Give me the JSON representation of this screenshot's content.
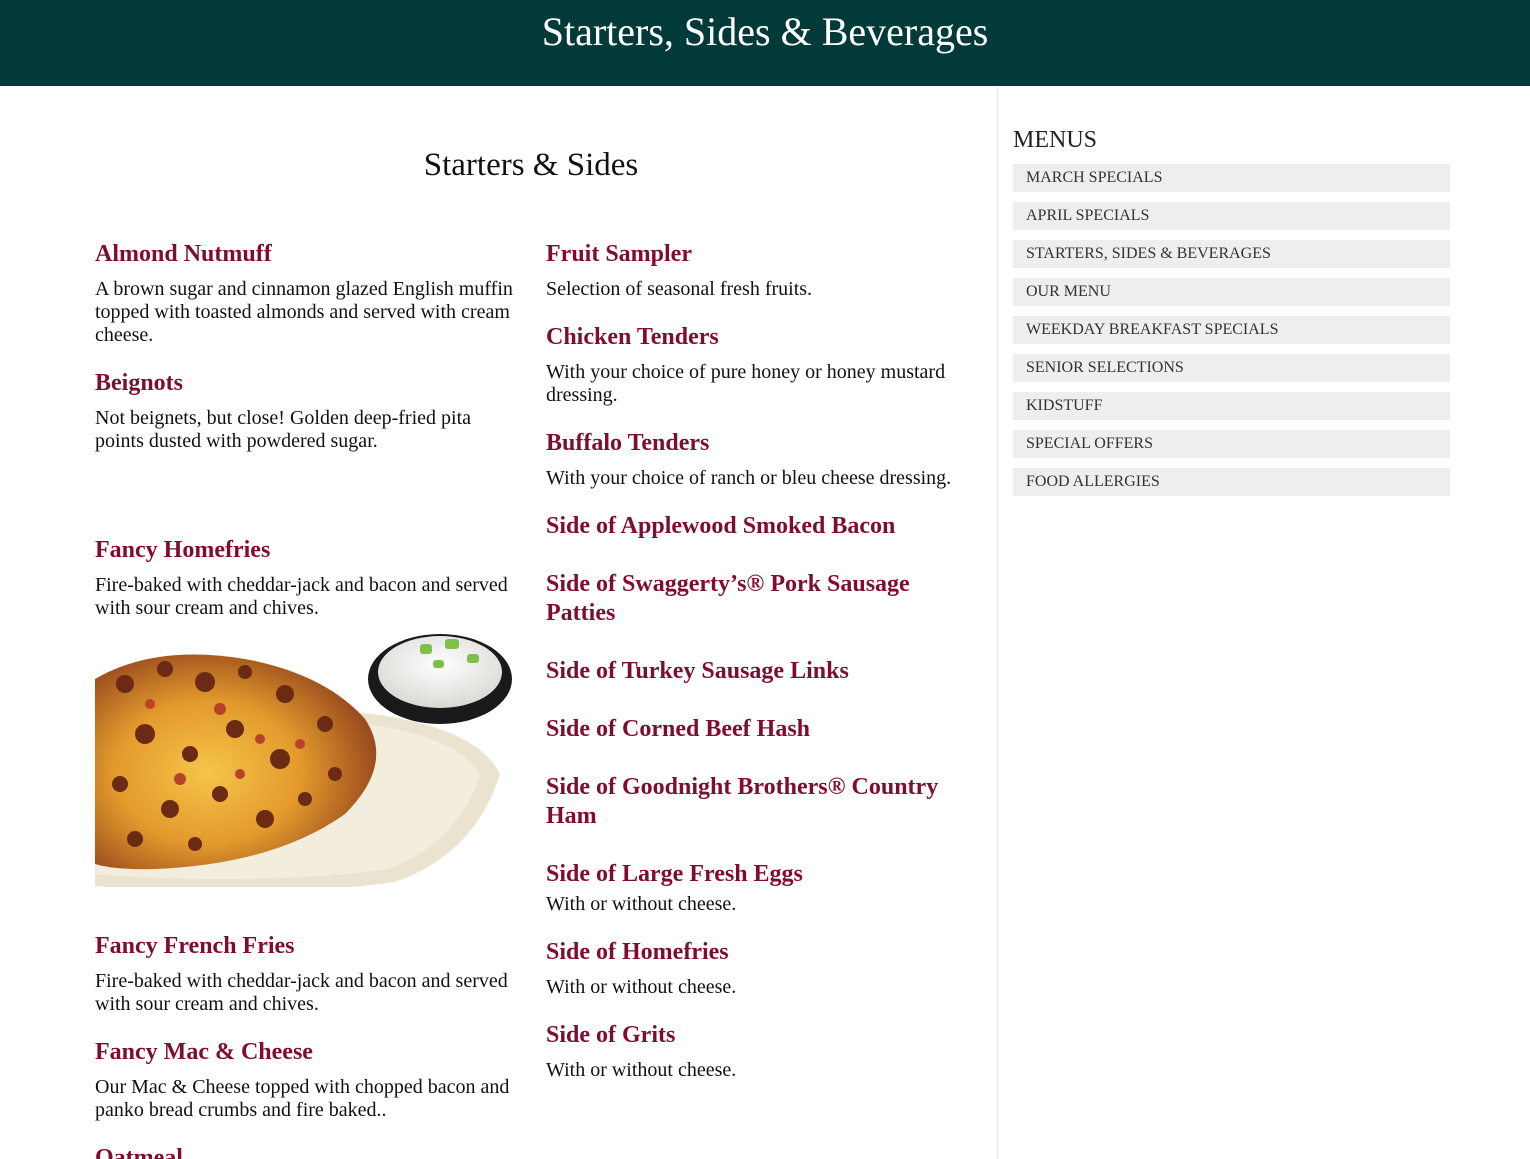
{
  "header": {
    "title": "Starters, Sides & Beverages"
  },
  "section": {
    "title": "Starters & Sides"
  },
  "left_items": [
    {
      "name": "Almond Nutmuff",
      "desc": "A brown sugar and cinnamon glazed English muffin topped with toasted almonds and served with cream cheese."
    },
    {
      "name": "Beignots",
      "desc": "Not beignets, but close! Golden deep-fried pita points dusted with powdered sugar."
    },
    {
      "name": "Fancy Homefries",
      "desc": "Fire-baked with cheddar-jack and bacon and served with sour cream and chives."
    },
    {
      "name": "Fancy French Fries",
      "desc": "Fire-baked with cheddar-jack and bacon and served with sour cream and chives."
    },
    {
      "name": "Fancy Mac & Cheese",
      "desc": "Our Mac & Cheese topped with chopped bacon and panko bread crumbs and fire baked.."
    },
    {
      "name": "Oatmeal",
      "desc": ""
    }
  ],
  "right_items": [
    {
      "name": "Fruit Sampler",
      "desc": "Selection of seasonal fresh fruits."
    },
    {
      "name": "Chicken Tenders",
      "desc": "With your choice of pure honey or honey mustard dressing."
    },
    {
      "name": "Buffalo Tenders",
      "desc": "With your choice of ranch or bleu cheese dressing."
    },
    {
      "name": "Side of Applewood Smoked Bacon",
      "desc": ""
    },
    {
      "name": "Side of Swaggerty’s® Pork Sausage Patties",
      "desc": ""
    },
    {
      "name": "Side of Turkey Sausage Links",
      "desc": ""
    },
    {
      "name": "Side of Corned Beef Hash",
      "desc": ""
    },
    {
      "name": "Side of Goodnight Brothers® Country Ham",
      "desc": ""
    },
    {
      "name": "Side of Large Fresh Eggs",
      "desc": "With or without cheese."
    },
    {
      "name": "Side of Homefries",
      "desc": "With or without cheese."
    },
    {
      "name": "Side of Grits",
      "desc": "With or without cheese."
    }
  ],
  "sidebar": {
    "title": "MENUS",
    "items": [
      "MARCH SPECIALS",
      "APRIL SPECIALS",
      "STARTERS, SIDES & BEVERAGES",
      "OUR MENU",
      "WEEKDAY BREAKFAST SPECIALS",
      "SENIOR SELECTIONS",
      "KIDSTUFF",
      "SPECIAL OFFERS",
      "FOOD ALLERGIES"
    ]
  },
  "colors": {
    "header_bg": "#013a38",
    "item_title": "#7f0d2f",
    "menu_bg": "#eeeeee"
  }
}
